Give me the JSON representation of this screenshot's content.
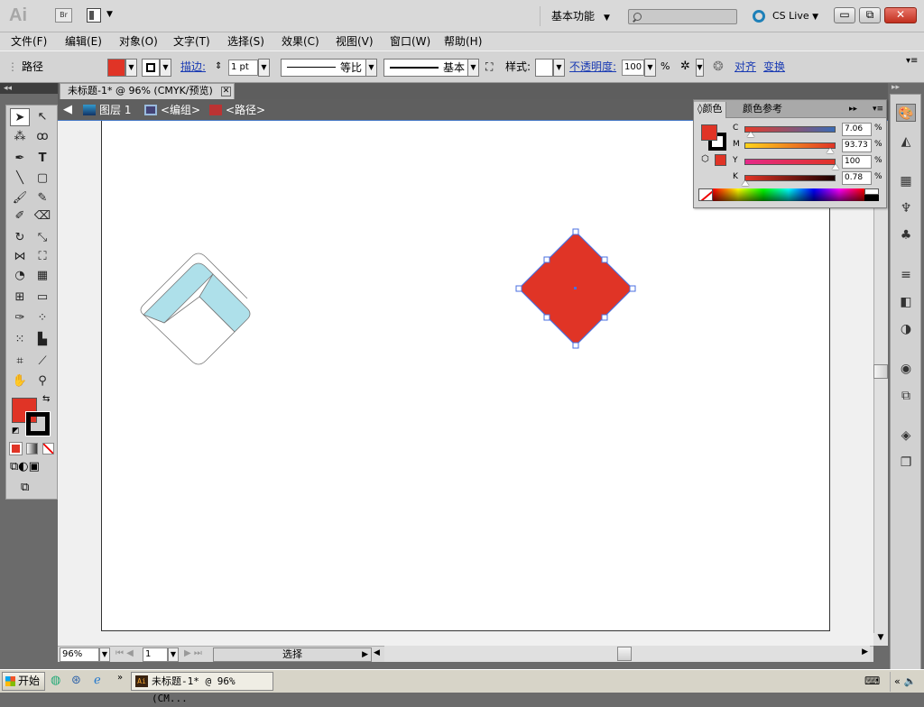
{
  "app": {
    "logo": "Ai",
    "bridge_label": "Br",
    "workspace": "基本功能",
    "cs_live": "CS Live"
  },
  "window_buttons": {
    "minimize": "▭",
    "restore": "⧉",
    "close": "✕"
  },
  "menus": [
    "文件(F)",
    "编辑(E)",
    "对象(O)",
    "文字(T)",
    "选择(S)",
    "效果(C)",
    "视图(V)",
    "窗口(W)",
    "帮助(H)"
  ],
  "control_bar": {
    "object_type": "路径",
    "stroke_label": "描边:",
    "stroke_weight": "1 pt",
    "profile_label": "等比",
    "brush_label": "基本",
    "style_label": "样式:",
    "opacity_label": "不透明度:",
    "opacity_value": "100",
    "percent": "%",
    "align_label": "对齐",
    "transform_label": "变换",
    "fill_color": "#e03426",
    "stroke_color": "#000000"
  },
  "document": {
    "tab_title": "未标题-1* @ 96% (CMYK/预览)",
    "breadcrumb": [
      "图层 1",
      "<编组>",
      "<路径>"
    ]
  },
  "color_panel": {
    "tabs": [
      "颜色",
      "颜色参考"
    ],
    "channels": [
      {
        "name": "C",
        "value": "7.06",
        "unit": "%",
        "level": 0.0706
      },
      {
        "name": "M",
        "value": "93.73",
        "unit": "%",
        "level": 0.9373
      },
      {
        "name": "Y",
        "value": "100",
        "unit": "%",
        "level": 1.0
      },
      {
        "name": "K",
        "value": "0.78",
        "unit": "%",
        "level": 0.0078
      }
    ],
    "fill_color": "#e03426"
  },
  "status": {
    "zoom": "96%",
    "page": "1",
    "tool_name": "选择"
  },
  "taskbar": {
    "start": "开始",
    "task_item": "未标题-1* @ 96% (CM..."
  }
}
